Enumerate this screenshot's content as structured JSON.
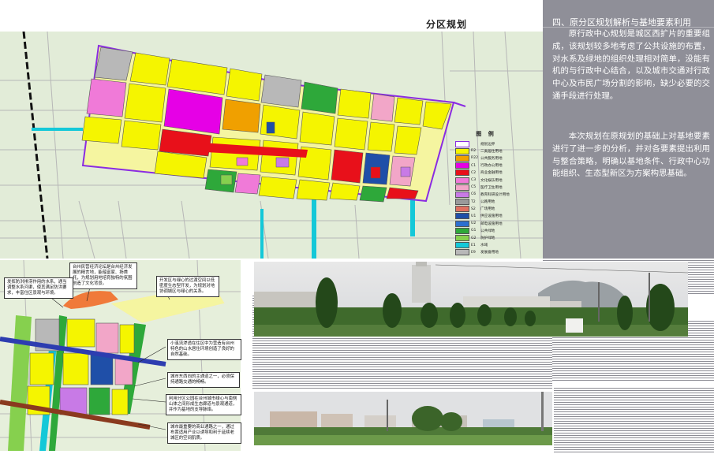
{
  "main_map": {
    "section_title": "分区规划"
  },
  "legend": {
    "title": "图 例",
    "items": [
      {
        "code": "",
        "label": "规划边界",
        "color": "#ffffff",
        "border": "#8a2be2"
      },
      {
        "code": "R2",
        "label": "二类居住用地",
        "color": "#f5f500",
        "border": "#555555"
      },
      {
        "code": "R22",
        "label": "公共服务用地",
        "color": "#f0a000",
        "border": "#555555"
      },
      {
        "code": "C1",
        "label": "行政办公用地",
        "color": "#e600e6",
        "border": "#555555"
      },
      {
        "code": "C2",
        "label": "商业金融用地",
        "color": "#e8101a",
        "border": "#555555"
      },
      {
        "code": "C3",
        "label": "文化娱乐用地",
        "color": "#f07ad8",
        "border": "#555555"
      },
      {
        "code": "C5",
        "label": "医疗卫生用地",
        "color": "#f2a6c8",
        "border": "#555555"
      },
      {
        "code": "C6",
        "label": "教育科研设计用地",
        "color": "#c87ae6",
        "border": "#555555"
      },
      {
        "code": "T2",
        "label": "公路用地",
        "color": "#9a9a9a",
        "border": "#555555"
      },
      {
        "code": "S2",
        "label": "广场用地",
        "color": "#e07060",
        "border": "#555555"
      },
      {
        "code": "U1",
        "label": "供应设施用地",
        "color": "#1f4fa8",
        "border": "#555555"
      },
      {
        "code": "U2",
        "label": "邮电设施用地",
        "color": "#2d6fd0",
        "border": "#555555"
      },
      {
        "code": "G1",
        "label": "公共绿地",
        "color": "#2ea83a",
        "border": "#555555"
      },
      {
        "code": "G2",
        "label": "防护绿地",
        "color": "#86d04e",
        "border": "#555555"
      },
      {
        "code": "E1",
        "label": "水域",
        "color": "#14c8d8",
        "border": "#555555"
      },
      {
        "code": "E9",
        "label": "发展备用地",
        "color": "#b8b8b8",
        "border": "#555555"
      }
    ]
  },
  "right_panel": {
    "heading": "四、原分区规划解析与基地要素利用",
    "paragraph_1": "原行政中心规划是城区西扩片的重要组成，该规划较多地考虑了公共设施的布置，对水系及绿地的组织处理相对简单，没能有机的与行政中心结合，以及城市交通对行政中心及市民广场分割的影响，缺少必要的交通手段进行处理。",
    "paragraph_2": "本次规划在原规划的基础上对基地要素进行了进一步的分析，并对各要素提出利用与整合策略，明确以基地条件、行政中心功能组织、生态型新区为方案构思基础。"
  },
  "lower_map": {
    "notes": [
      "台州民营经济论坛是台州经济发展的精言地，能蕴富家、扬首托，为规划用地培育独特的氛围创造了文化背景。",
      "发挥防洪排涝作用的水系，通当调整水系河渠，使其满足防洪要求，丰富住区景观与环境。",
      "开发区与绿心的过渡空间以低密度生态型开发，为规划对地协调城区与绿心的关系。",
      "小溪流渗透在住区中为营造有台州特色的山水居住环境创造了良好的自然基础。",
      "城市东西向的主通道之一，必须保持通路交通的畅畅。",
      "利用分区公园在台州城市绿心与南侧山体之间形成生态廊道与景观通道，并作为基地的支导脉络。",
      "城市最重要的商业通路之一，通过布置适用产业以诱导和利于延续老城区的空间肌质。"
    ]
  },
  "photos": {
    "top": {
      "description_visible": false
    },
    "bottom": {
      "description_visible": false
    }
  }
}
